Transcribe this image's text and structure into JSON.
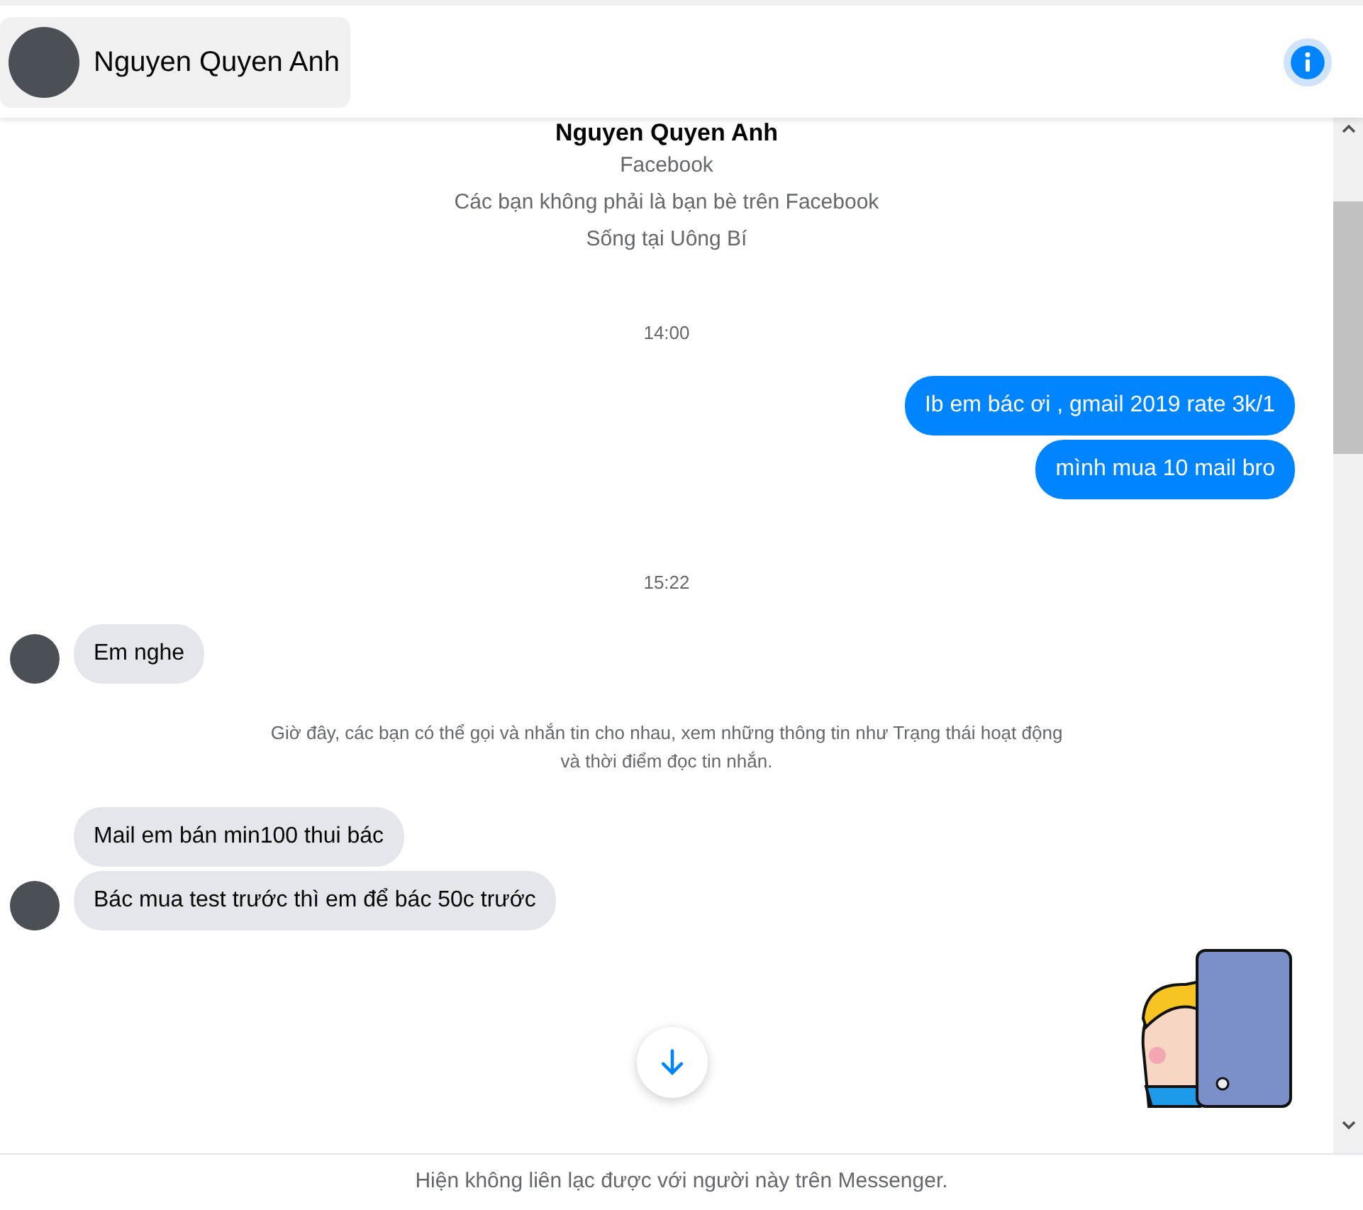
{
  "header": {
    "name": "Nguyen Quyen Anh"
  },
  "profile": {
    "name": "Nguyen Quyen Anh",
    "lines": [
      "Facebook",
      "Các bạn không phải là bạn bè trên Facebook",
      "Sống tại Uông Bí"
    ]
  },
  "messages": [
    {
      "kind": "time",
      "text": "14:00"
    },
    {
      "kind": "out",
      "text": "Ib em bác ơi , gmail 2019 rate 3k/1"
    },
    {
      "kind": "out",
      "text": "mình mua 10 mail bro"
    },
    {
      "kind": "time",
      "text": "15:22"
    },
    {
      "kind": "in",
      "text": "Em nghe",
      "avatar": true
    },
    {
      "kind": "notice",
      "text": "Giờ đây, các bạn có thể gọi và nhắn tin cho nhau, xem những thông tin như Trạng thái hoạt động và thời điểm đọc tin nhắn."
    },
    {
      "kind": "in",
      "text": "Mail em bán min100 thui bác",
      "avatar": false
    },
    {
      "kind": "in",
      "text": "Bác mua test trước thì em để bác 50c trước",
      "avatar": true
    }
  ],
  "footer": {
    "text": "Hiện không liên lạc được với người này trên Messenger."
  }
}
